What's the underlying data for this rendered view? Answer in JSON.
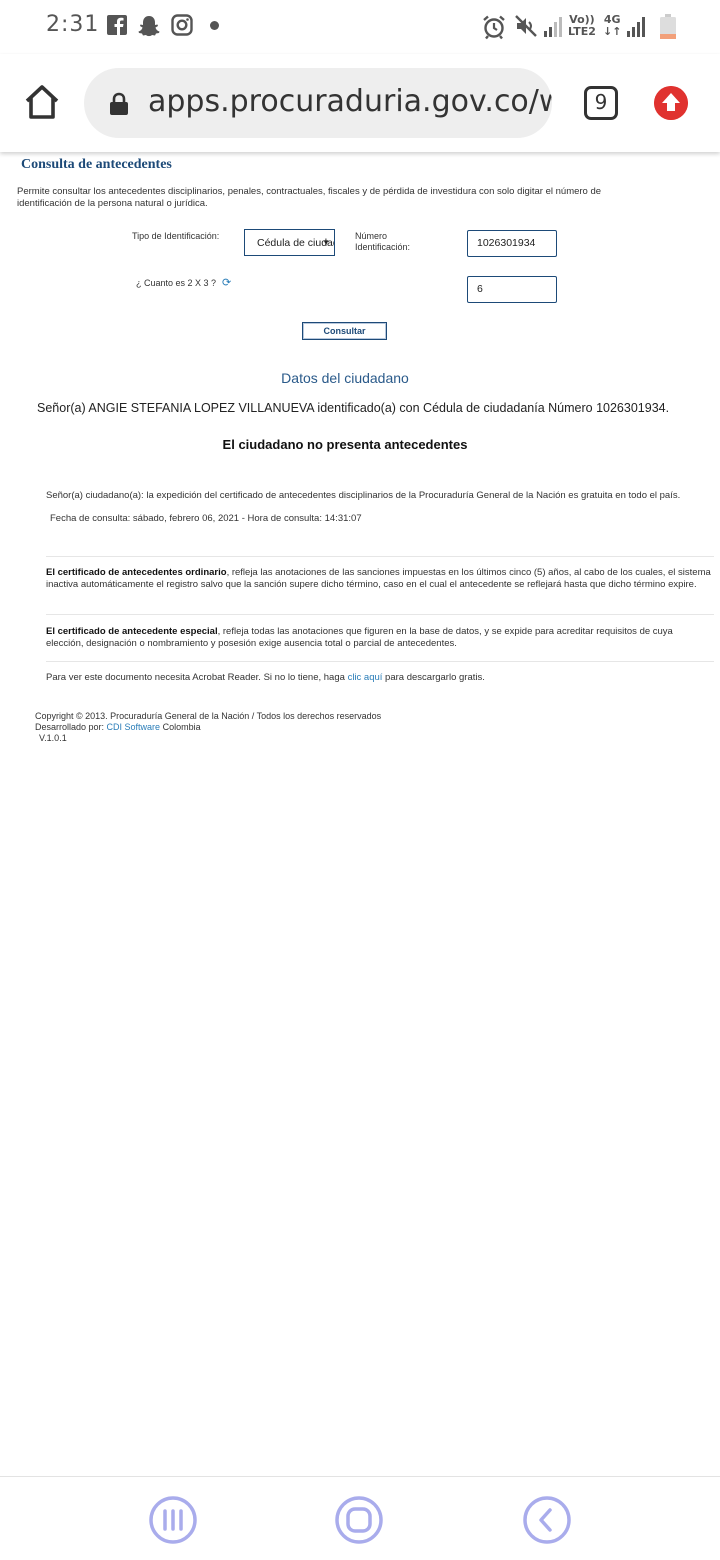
{
  "status_bar": {
    "time": "2:31",
    "icons": [
      "facebook-icon",
      "snapchat-icon",
      "instagram-icon",
      "notification-dot-icon",
      "alarm-icon",
      "mute-icon",
      "signal-icon",
      "signal-icon",
      "battery-icon"
    ],
    "network_1_top": "Vo))",
    "network_1_bottom": "LTE2",
    "network_2_top": "4G",
    "network_2_bottom": "↓↑"
  },
  "browser": {
    "url": "apps.procuraduria.gov.co/webcert/",
    "tab_count": "9",
    "colors": {
      "update_button": "#e0322f"
    }
  },
  "page": {
    "heading": "Consulta de antecedentes",
    "intro": "Permite consultar los antecedentes disciplinarios, penales, contractuales, fiscales y de pérdida de investidura con solo digitar el número de identificación de la persona natural o jurídica.",
    "form": {
      "tipo_label": "Tipo de Identificación:",
      "tipo_value": "Cédula de ciudadanía",
      "numero_label": "Número Identificación:",
      "numero_value": "1026301934",
      "captcha_label": "¿ Cuanto es 2 X 3 ?",
      "captcha_value": "6",
      "submit_label": "Consultar"
    },
    "result": {
      "title": "Datos del ciudadano",
      "citizen_line": "Señor(a)  ANGIE STEFANIA LOPEZ VILLANUEVA identificado(a) con Cédula de ciudadanía Número 1026301934.",
      "status": "El ciudadano no presenta antecedentes",
      "notice": "Señor(a) ciudadano(a): la expedición del certificado de antecedentes disciplinarios de la Procuraduría General de la Nación es gratuita en todo el país.",
      "fecha": "Fecha de consulta: sábado, febrero 06, 2021 - Hora de consulta: 14:31:07"
    },
    "info": {
      "ordinario_bold": "El certificado de antecedentes ordinario",
      "ordinario_text": ", refleja las anotaciones de las sanciones impuestas en los últimos cinco (5) años, al cabo de los cuales, el sistema inactiva automáticamente el registro salvo que la sanción supere dicho término, caso en el cual el antecedente se reflejará hasta que dicho término expire.",
      "especial_bold": "El certificado de antecedente especial",
      "especial_text": ", refleja todas las anotaciones que figuren en la base de datos, y se expide para acreditar requisitos de cuya elección, designación o nombramiento y posesión exige ausencia total o parcial de antecedentes.",
      "acrobat_pre": "Para ver este documento necesita Acrobat Reader. Si no lo tiene, haga ",
      "acrobat_link": "clic aquí",
      "acrobat_post": " para descargarlo gratis."
    },
    "footer": {
      "copyright": "Copyright © 2013. Procuraduría General de la Nación / Todos los derechos reservados",
      "dev_prefix": "Desarrollado por: ",
      "dev_link": "CDI Software",
      "dev_suffix": " Colombia",
      "version": "V.1.0.1"
    }
  },
  "nav_bar": {
    "icons": [
      "recent-apps-icon",
      "home-icon",
      "back-icon"
    ],
    "colors": {
      "nav_icon": "#a9acec"
    }
  }
}
